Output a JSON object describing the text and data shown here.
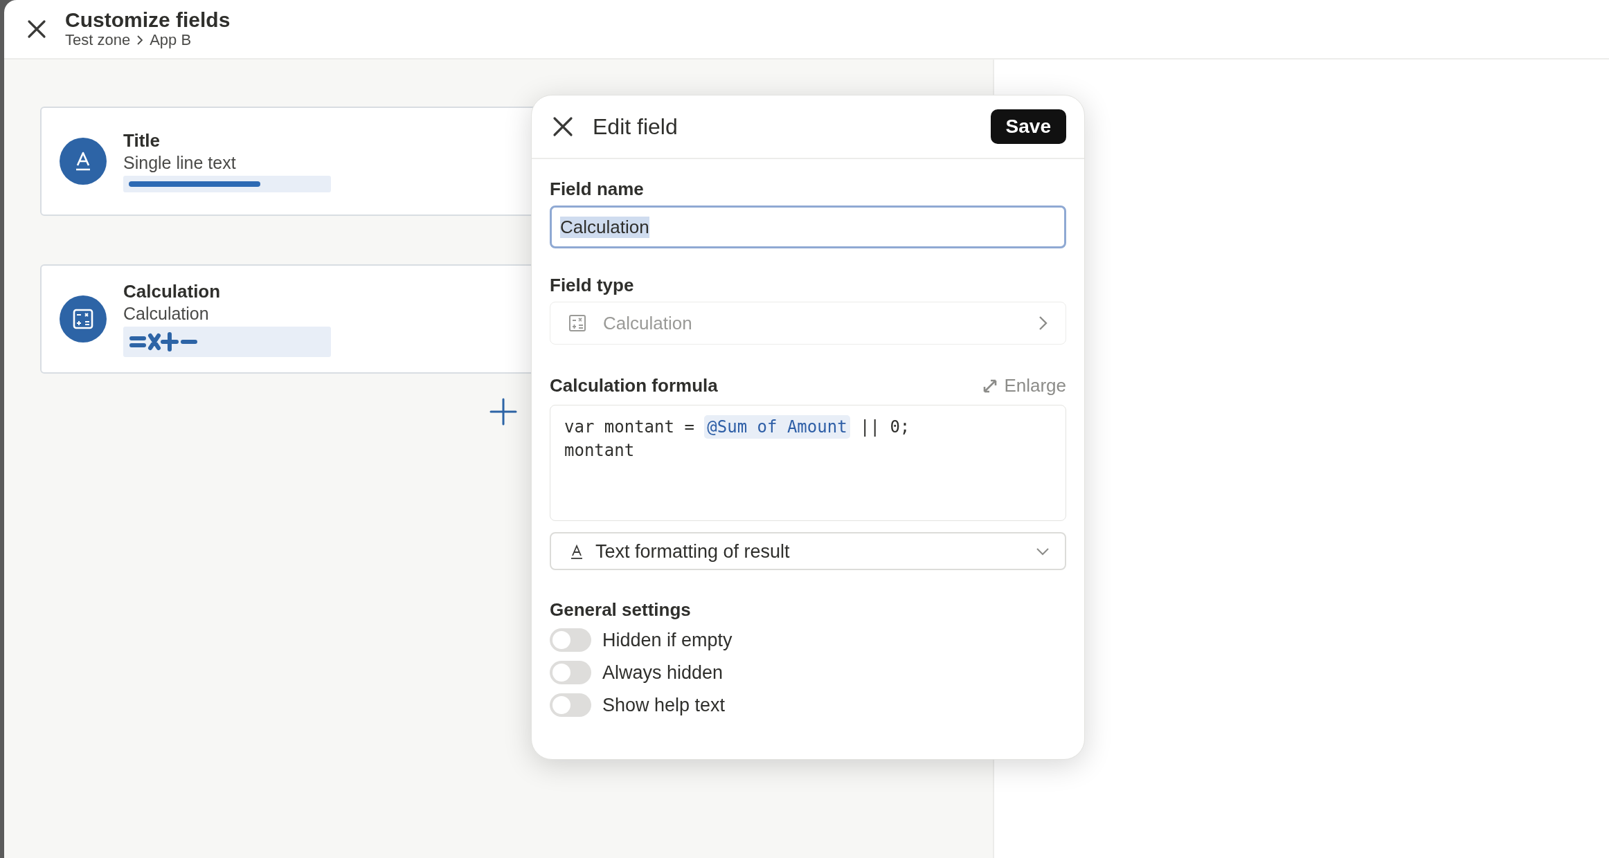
{
  "header": {
    "title": "Customize fields",
    "breadcrumb": [
      "Test zone",
      "App B"
    ]
  },
  "fields": [
    {
      "kind": "text",
      "name": "Title",
      "type": "Single line text"
    },
    {
      "kind": "calculation",
      "name": "Calculation",
      "type": "Calculation"
    }
  ],
  "dialog": {
    "title": "Edit field",
    "save": "Save",
    "field_name": {
      "label": "Field name",
      "value": "Calculation"
    },
    "field_type": {
      "label": "Field type",
      "value": "Calculation",
      "disabled": true
    },
    "formula": {
      "label": "Calculation formula",
      "enlarge": "Enlarge",
      "lines": [
        [
          {
            "kind": "code",
            "text": "var montant = "
          },
          {
            "kind": "reference",
            "text": "@Sum of Amount"
          },
          {
            "kind": "code",
            "text": " || 0;"
          }
        ],
        [
          {
            "kind": "code",
            "text": "montant"
          }
        ]
      ]
    },
    "formatting": {
      "label": "Text formatting of result"
    },
    "general_settings": {
      "title": "General settings",
      "toggles": [
        {
          "label": "Hidden if empty",
          "on": false
        },
        {
          "label": "Always hidden",
          "on": false
        },
        {
          "label": "Show help text",
          "on": false
        }
      ]
    }
  }
}
